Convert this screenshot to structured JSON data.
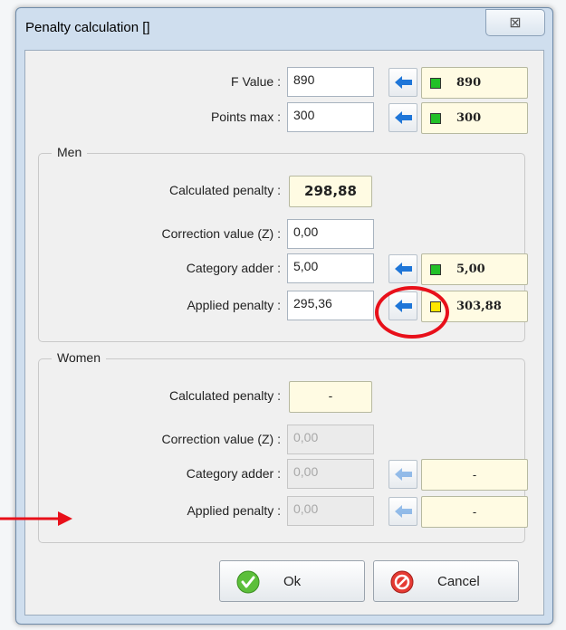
{
  "dialog": {
    "title": "Penalty calculation []",
    "close_icon": "close-icon"
  },
  "top": {
    "f_value": {
      "label": "F Value :",
      "input": "890",
      "result": "890",
      "status": "green"
    },
    "points_max": {
      "label": "Points max :",
      "input": "300",
      "result": "300",
      "status": "green"
    }
  },
  "men": {
    "title": "Men",
    "calculated_penalty": {
      "label": "Calculated penalty :",
      "value": "298,88"
    },
    "correction_value": {
      "label": "Correction value (Z) :",
      "input": "0,00"
    },
    "category_adder": {
      "label": "Category adder :",
      "input": "5,00",
      "result": "5,00",
      "status": "green"
    },
    "applied_penalty": {
      "label": "Applied penalty :",
      "input": "295,36",
      "result": "303,88",
      "status": "yellow"
    }
  },
  "women": {
    "title": "Women",
    "calculated_penalty": {
      "label": "Calculated penalty :",
      "value": "-"
    },
    "correction_value": {
      "label": "Correction value (Z) :",
      "input": "0,00"
    },
    "category_adder": {
      "label": "Category adder :",
      "input": "0,00",
      "result": "-"
    },
    "applied_penalty": {
      "label": "Applied penalty :",
      "input": "0,00",
      "result": "-"
    }
  },
  "buttons": {
    "ok": "Ok",
    "cancel": "Cancel"
  },
  "colors": {
    "status_green": "#22c028",
    "status_yellow": "#ffe600",
    "annotation_red": "#e8101a",
    "arrow_blue": "#1f76d8"
  },
  "icons": {
    "arrow": "arrow-left-icon",
    "ok": "check-circle-icon",
    "cancel": "no-entry-icon"
  }
}
